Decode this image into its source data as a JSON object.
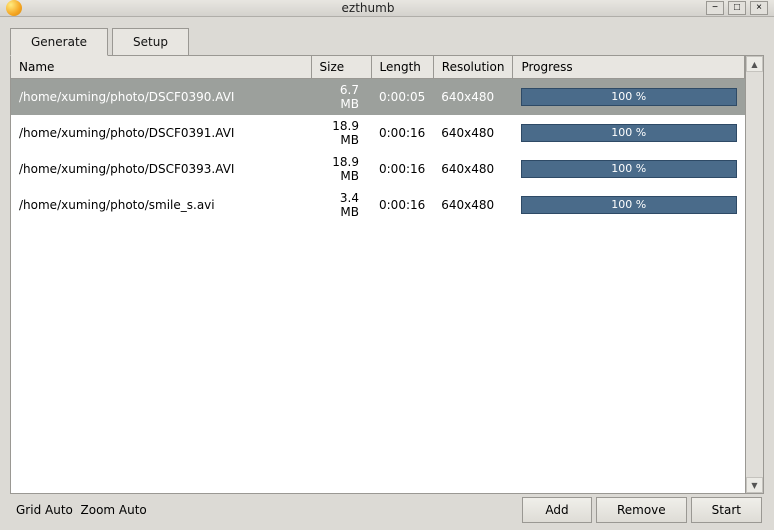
{
  "window": {
    "title": "ezthumb",
    "minimize": "−",
    "maximize": "□",
    "close": "×"
  },
  "tabs": {
    "generate": "Generate",
    "setup": "Setup",
    "active": "generate"
  },
  "columns": {
    "name": "Name",
    "size": "Size",
    "length": "Length",
    "resolution": "Resolution",
    "progress": "Progress"
  },
  "rows": [
    {
      "name": "/home/xuming/photo/DSCF0390.AVI",
      "size": "6.7 MB",
      "length": "0:00:05",
      "resolution": "640x480",
      "progress": "100 %",
      "selected": true
    },
    {
      "name": "/home/xuming/photo/DSCF0391.AVI",
      "size": "18.9 MB",
      "length": "0:00:16",
      "resolution": "640x480",
      "progress": "100 %",
      "selected": false
    },
    {
      "name": "/home/xuming/photo/DSCF0393.AVI",
      "size": "18.9 MB",
      "length": "0:00:16",
      "resolution": "640x480",
      "progress": "100 %",
      "selected": false
    },
    {
      "name": "/home/xuming/photo/smile_s.avi",
      "size": "3.4 MB",
      "length": "0:00:16",
      "resolution": "640x480",
      "progress": "100 %",
      "selected": false
    }
  ],
  "status": {
    "grid": "Grid Auto",
    "zoom": "Zoom Auto"
  },
  "buttons": {
    "add": "Add",
    "remove": "Remove",
    "start": "Start"
  }
}
